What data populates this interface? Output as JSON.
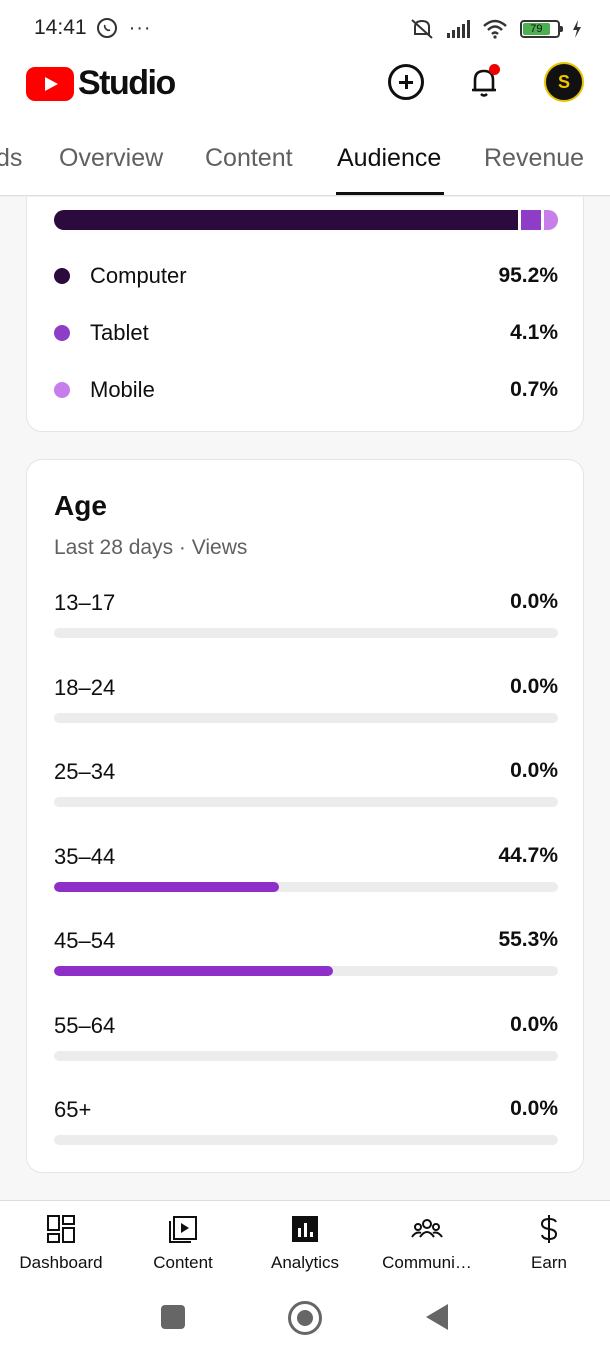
{
  "status_bar": {
    "time": "14:41",
    "battery": "79"
  },
  "app": {
    "logo_text": "Studio"
  },
  "tabs": [
    {
      "label": "ds"
    },
    {
      "label": "Overview"
    },
    {
      "label": "Content"
    },
    {
      "label": "Audience",
      "active": true
    },
    {
      "label": "Revenue"
    }
  ],
  "device_card": {
    "items": [
      {
        "label": "Computer",
        "value": "95.2%",
        "color": "#2b0a3d",
        "fraction": 0.952
      },
      {
        "label": "Tablet",
        "value": "4.1%",
        "color": "#8e3dc6",
        "fraction": 0.041
      },
      {
        "label": "Mobile",
        "value": "0.7%",
        "color": "#c77dea",
        "fraction": 0.007
      }
    ]
  },
  "age_card": {
    "title": "Age",
    "subtitle": "Last 28 days · Views",
    "rows": [
      {
        "label": "13–17",
        "value": "0.0%",
        "fraction": 0.0
      },
      {
        "label": "18–24",
        "value": "0.0%",
        "fraction": 0.0
      },
      {
        "label": "25–34",
        "value": "0.0%",
        "fraction": 0.0
      },
      {
        "label": "35–44",
        "value": "44.7%",
        "fraction": 0.447
      },
      {
        "label": "45–54",
        "value": "55.3%",
        "fraction": 0.553
      },
      {
        "label": "55–64",
        "value": "0.0%",
        "fraction": 0.0
      },
      {
        "label": "65+",
        "value": "0.0%",
        "fraction": 0.0
      }
    ],
    "bar_color": "#8e2fc7"
  },
  "bottom_nav": [
    {
      "label": "Dashboard",
      "icon": "dashboard-icon"
    },
    {
      "label": "Content",
      "icon": "content-icon"
    },
    {
      "label": "Analytics",
      "icon": "analytics-icon",
      "active": true
    },
    {
      "label": "Communi…",
      "icon": "community-icon"
    },
    {
      "label": "Earn",
      "icon": "earn-icon"
    }
  ],
  "colors": {
    "brand_red": "#ff0000",
    "accent_purple": "#8e2fc7"
  }
}
